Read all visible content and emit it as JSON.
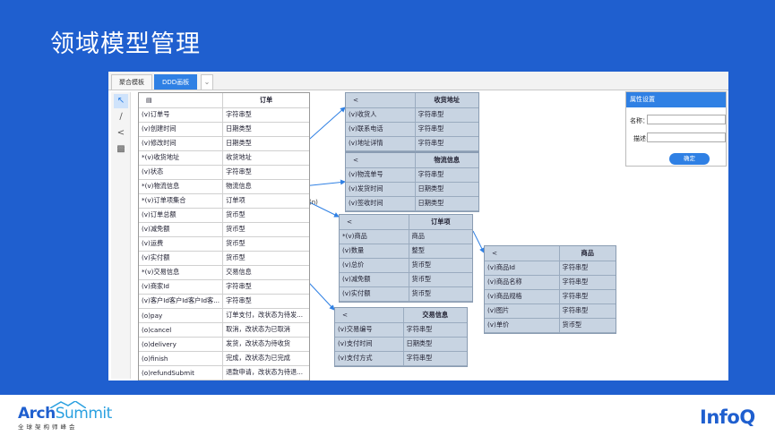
{
  "slide": {
    "title": "领域模型管理"
  },
  "tabs": [
    {
      "label": "聚合模板",
      "active": false
    },
    {
      "label": "DDD画板",
      "active": true
    }
  ],
  "tab_more_icon": "chevron-down-icon",
  "tools": [
    "cursor-icon",
    "line-icon",
    "share-icon",
    "puzzle-icon"
  ],
  "entities": {
    "order": {
      "icon": "table-icon",
      "title": "订单",
      "rows": [
        {
          "name": "(v)订单号",
          "type": "字符串型"
        },
        {
          "name": "(v)创建时间",
          "type": "日期类型"
        },
        {
          "name": "(v)修改时间",
          "type": "日期类型"
        },
        {
          "name": "*(v)收货地址",
          "type": "收货地址"
        },
        {
          "name": "(v)状态",
          "type": "字符串型"
        },
        {
          "name": "*(v)物流信息",
          "type": "物流信息"
        },
        {
          "name": "*(v)订单项集合",
          "type": "订单项"
        },
        {
          "name": "(v)订单总额",
          "type": "货币型"
        },
        {
          "name": "(v)减免额",
          "type": "货币型"
        },
        {
          "name": "(v)运费",
          "type": "货币型"
        },
        {
          "name": "(v)实付额",
          "type": "货币型"
        },
        {
          "name": "*(v)交易信息",
          "type": "交易信息"
        },
        {
          "name": "(v)商家Id",
          "type": "字符串型"
        },
        {
          "name": "(v)客户Id客户Id客户Id客...",
          "type": "字符串型"
        },
        {
          "name": "(o)pay",
          "type": "订单支付，改状态为待发..."
        },
        {
          "name": "(o)cancel",
          "type": "取消，改状态为已取消"
        },
        {
          "name": "(o)delivery",
          "type": "发货，改状态为待收货"
        },
        {
          "name": "(o)finish",
          "type": "完成，改状态为已完成"
        },
        {
          "name": "(o)refundSubmit",
          "type": "退款申请，改状态为待退..."
        }
      ]
    },
    "address": {
      "icon": "share-icon",
      "title": "收货地址",
      "rows": [
        {
          "name": "(v)收货人",
          "type": "字符串型"
        },
        {
          "name": "(v)联系电话",
          "type": "字符串型"
        },
        {
          "name": "(v)地址详情",
          "type": "字符串型"
        }
      ]
    },
    "logistics": {
      "icon": "share-icon",
      "title": "物流信息",
      "rows": [
        {
          "name": "(v)物流单号",
          "type": "字符串型"
        },
        {
          "name": "(v)发货时间",
          "type": "日期类型"
        },
        {
          "name": "(v)签收时间",
          "type": "日期类型"
        }
      ]
    },
    "order_item": {
      "icon": "share-icon",
      "title": "订单项",
      "rows": [
        {
          "name": "*(v)商品",
          "type": "商品"
        },
        {
          "name": "(v)数量",
          "type": "整型"
        },
        {
          "name": "(v)总价",
          "type": "货币型"
        },
        {
          "name": "(v)减免额",
          "type": "货币型"
        },
        {
          "name": "(v)实付额",
          "type": "货币型"
        }
      ]
    },
    "product": {
      "icon": "share-icon",
      "title": "商品",
      "rows": [
        {
          "name": "(v)商品Id",
          "type": "字符串型"
        },
        {
          "name": "(v)商品名称",
          "type": "字符串型"
        },
        {
          "name": "(v)商品规格",
          "type": "字符串型"
        },
        {
          "name": "(v)图片",
          "type": "字符串型"
        },
        {
          "name": "(v)单价",
          "type": "货币型"
        }
      ]
    },
    "payment": {
      "icon": "share-icon",
      "title": "交易信息",
      "rows": [
        {
          "name": "(v)交易编号",
          "type": "字符串型"
        },
        {
          "name": "(v)支付时间",
          "type": "日期类型"
        },
        {
          "name": "(v)支付方式",
          "type": "字符串型"
        }
      ]
    }
  },
  "link_label": "(n)",
  "link_color": "#2f80e4",
  "properties": {
    "title": "属性设置",
    "name_label": "名称：",
    "desc_label": "描述:",
    "confirm_label": "确定"
  },
  "footer": {
    "arch_part1": "Arch",
    "arch_part2": "Summit",
    "arch_sub": "全球架构师峰会",
    "infoq": "InfoQ"
  }
}
